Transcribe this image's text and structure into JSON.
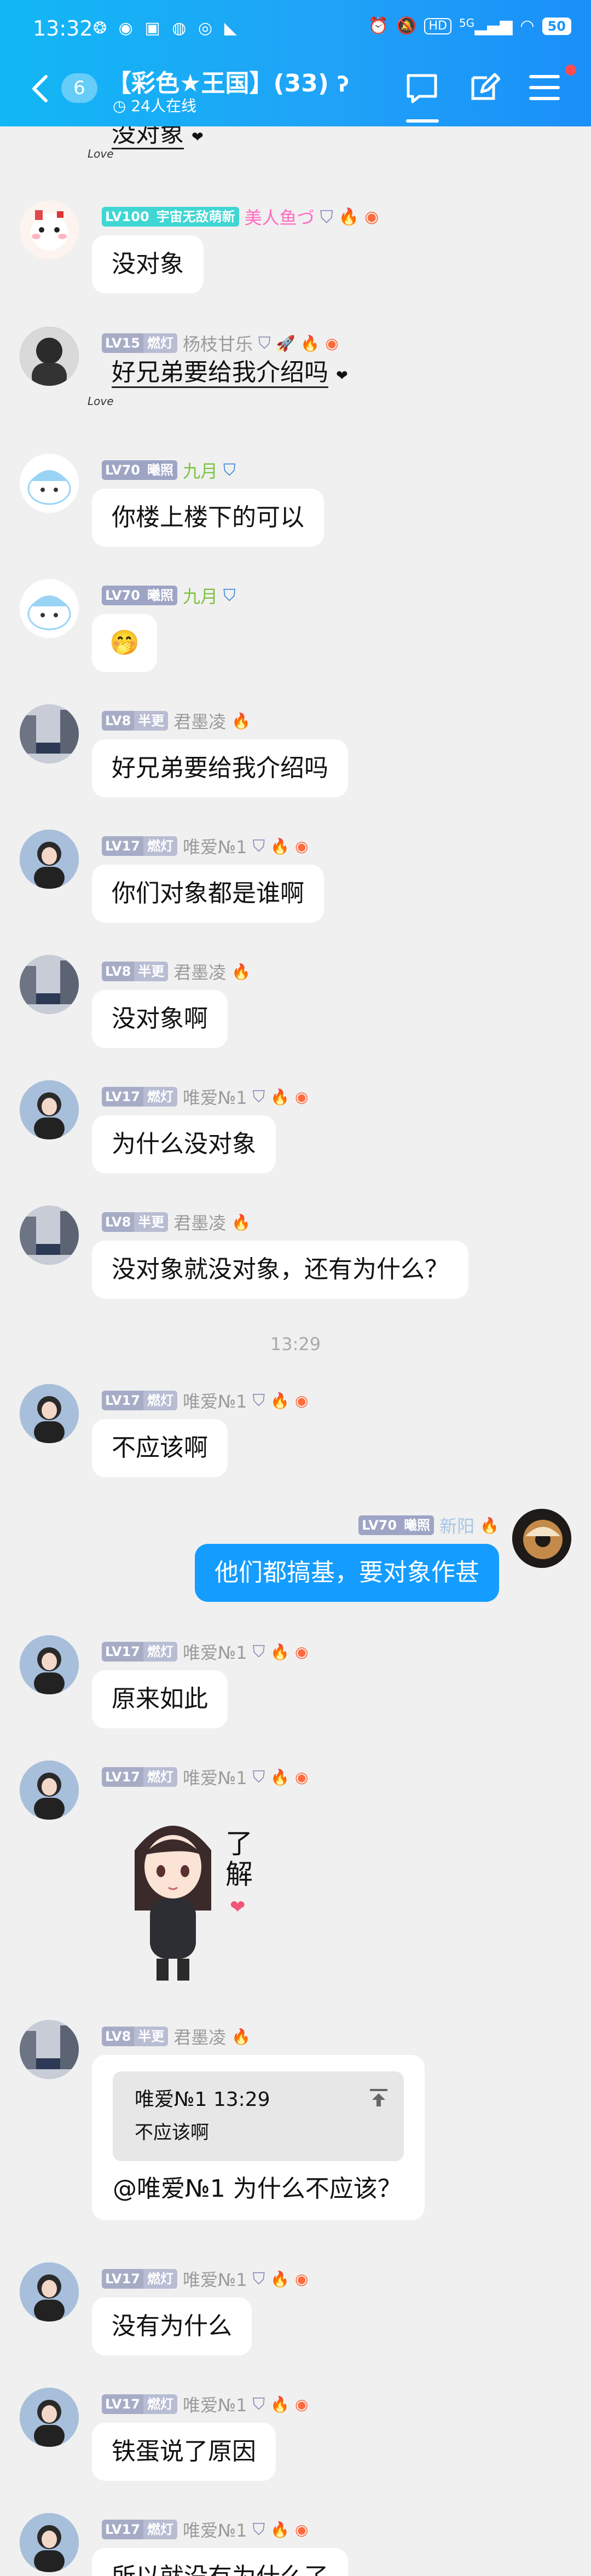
{
  "status_bar": {
    "time": "13:32",
    "left_icons": "❂ ◉ ▣ ◍ ◎ ◣",
    "hd": "HD",
    "signal": "5G",
    "battery": "50"
  },
  "header": {
    "unread_count": "6",
    "title": "【彩色★王国】(33)",
    "ear_icon": "ear-icon",
    "online": "24人在线"
  },
  "messages": [
    {
      "kind": "deco-text",
      "text": "没对象",
      "left_mark": "Love",
      "right_mark": "❤"
    },
    {
      "kind": "text",
      "level": "LV100",
      "title": "宇宙无敌萌新",
      "title_color": "#3fd6d3",
      "nick": "美人鱼づ",
      "nick_color": "#ff6bc1",
      "text": "没对象"
    },
    {
      "kind": "deco-text",
      "level": "LV15",
      "title": "燃灯",
      "nick": "杨枝甘乐",
      "text": "好兄弟要给我介绍吗",
      "left_mark": "Love",
      "right_mark": "❤"
    },
    {
      "kind": "text",
      "level": "LV70",
      "title": "曦照",
      "nick": "九月",
      "text": "你楼上楼下的可以"
    },
    {
      "kind": "emoji",
      "level": "LV70",
      "title": "曦照",
      "nick": "九月",
      "text": "🤭"
    },
    {
      "kind": "text",
      "level": "LV8",
      "title": "半更",
      "nick": "君墨凌",
      "text": "好兄弟要给我介绍吗"
    },
    {
      "kind": "text",
      "level": "LV17",
      "title": "燃灯",
      "nick": "唯爱№1",
      "text": "你们对象都是谁啊"
    },
    {
      "kind": "text",
      "level": "LV8",
      "title": "半更",
      "nick": "君墨凌",
      "text": "没对象啊"
    },
    {
      "kind": "text",
      "level": "LV17",
      "title": "燃灯",
      "nick": "唯爱№1",
      "text": "为什么没对象"
    },
    {
      "kind": "text",
      "level": "LV8",
      "title": "半更",
      "nick": "君墨凌",
      "text": "没对象就没对象，还有为什么？"
    },
    {
      "kind": "time",
      "text": "13:29"
    },
    {
      "kind": "text",
      "level": "LV17",
      "title": "燃灯",
      "nick": "唯爱№1",
      "text": "不应该啊"
    },
    {
      "kind": "self",
      "level": "LV70",
      "title": "曦照",
      "nick": "新阳",
      "text": "他们都搞基，要对象作甚"
    },
    {
      "kind": "text",
      "level": "LV17",
      "title": "燃灯",
      "nick": "唯爱№1",
      "text": "原来如此"
    },
    {
      "kind": "sticker",
      "level": "LV17",
      "title": "燃灯",
      "nick": "唯爱№1",
      "sticker_text": "了解"
    },
    {
      "kind": "reply",
      "level": "LV8",
      "title": "半更",
      "nick": "君墨凌",
      "quote_author": "唯爱№1",
      "quote_time": "13:29",
      "quote_text": "不应该啊",
      "text": "@唯爱№1 为什么不应该？"
    },
    {
      "kind": "text",
      "level": "LV17",
      "title": "燃灯",
      "nick": "唯爱№1",
      "text": "没有为什么"
    },
    {
      "kind": "text",
      "level": "LV17",
      "title": "燃灯",
      "nick": "唯爱№1",
      "text": "铁蛋说了原因"
    },
    {
      "kind": "text",
      "level": "LV17",
      "title": "燃灯",
      "nick": "唯爱№1",
      "text": "所以就没有为什么了"
    }
  ]
}
